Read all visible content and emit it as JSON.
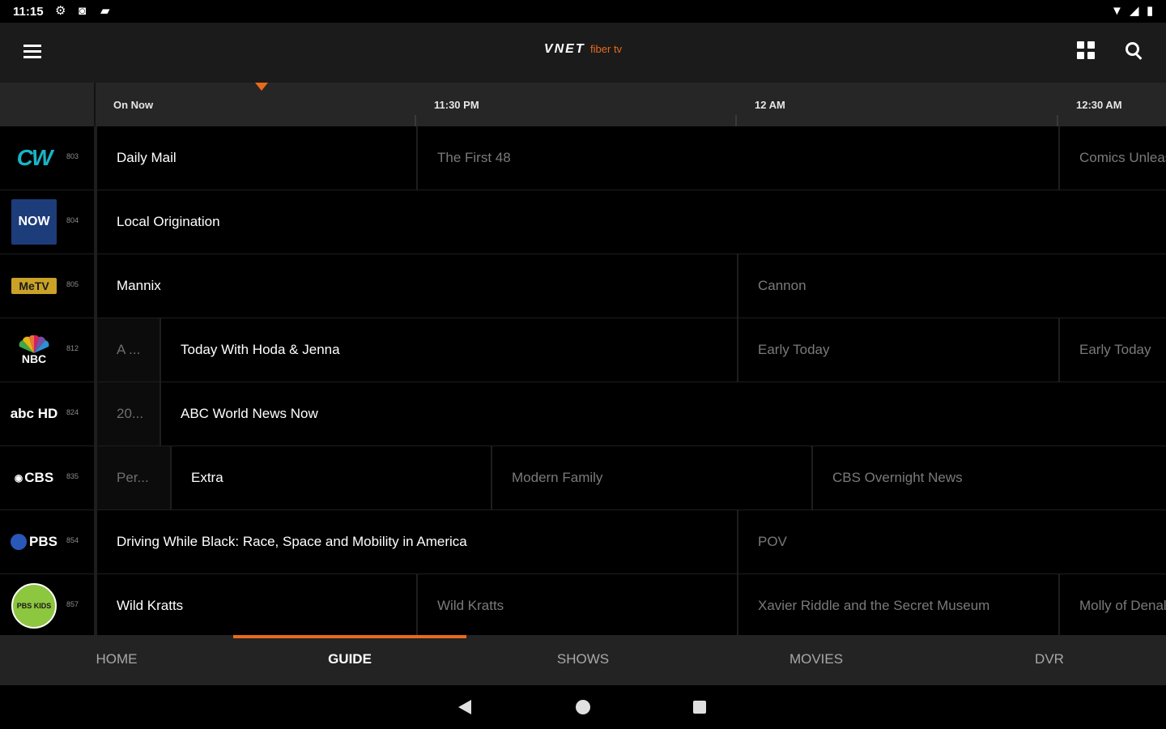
{
  "status_bar": {
    "time": "11:15",
    "left_icons": [
      "gear-icon",
      "square-icon",
      "sd-card-icon"
    ],
    "right_icons": [
      "wifi-icon",
      "signal-icon",
      "battery-icon"
    ]
  },
  "app_bar": {
    "logo_main": "VNET",
    "logo_sub": "fiber tv",
    "brand_color": "#e86a1b"
  },
  "time_header": {
    "slots": [
      "On Now",
      "11:30 PM",
      "12 AM",
      "12:30 AM"
    ]
  },
  "channels": [
    {
      "logo": "CW",
      "logo_color": "#19b4c6",
      "number": "803",
      "programs": [
        {
          "title": "Daily Mail",
          "state": "current"
        },
        {
          "title": "The First 48",
          "state": "future"
        },
        {
          "title": "Comics Unleashed",
          "state": "future"
        }
      ]
    },
    {
      "logo": "NOW",
      "logo_color": "#1d3c7a",
      "number": "804",
      "programs": [
        {
          "title": "Local Origination",
          "state": "current"
        }
      ]
    },
    {
      "logo": "MeTV",
      "logo_color": "#c9a227",
      "number": "805",
      "programs": [
        {
          "title": "Mannix",
          "state": "current"
        },
        {
          "title": "Cannon",
          "state": "future"
        }
      ]
    },
    {
      "logo": "NBC",
      "logo_color": "#ffffff",
      "number": "812",
      "programs": [
        {
          "title": "A ...",
          "state": "past"
        },
        {
          "title": "Today With Hoda & Jenna",
          "state": "current"
        },
        {
          "title": "Early Today",
          "state": "future"
        },
        {
          "title": "Early Today",
          "state": "future"
        }
      ]
    },
    {
      "logo": "abc HD",
      "logo_color": "#ffffff",
      "number": "824",
      "programs": [
        {
          "title": "20...",
          "state": "past"
        },
        {
          "title": "ABC World News Now",
          "state": "current"
        }
      ]
    },
    {
      "logo": "CBS",
      "logo_color": "#ffffff",
      "number": "835",
      "programs": [
        {
          "title": "Per...",
          "state": "past"
        },
        {
          "title": "Extra",
          "state": "current"
        },
        {
          "title": "Modern Family",
          "state": "future"
        },
        {
          "title": "CBS Overnight News",
          "state": "future"
        }
      ]
    },
    {
      "logo": "PBS",
      "logo_color": "#ffffff",
      "number": "854",
      "programs": [
        {
          "title": "Driving While Black: Race, Space and Mobility in America",
          "state": "current"
        },
        {
          "title": "POV",
          "state": "future"
        }
      ]
    },
    {
      "logo": "PBS KIDS",
      "logo_color": "#8dc63f",
      "number": "857",
      "programs": [
        {
          "title": "Wild Kratts",
          "state": "current"
        },
        {
          "title": "Wild Kratts",
          "state": "future"
        },
        {
          "title": "Xavier Riddle and the Secret Museum",
          "state": "future"
        },
        {
          "title": "Molly of Denali",
          "state": "future"
        }
      ]
    }
  ],
  "tabs": [
    {
      "label": "HOME",
      "active": false
    },
    {
      "label": "GUIDE",
      "active": true
    },
    {
      "label": "SHOWS",
      "active": false
    },
    {
      "label": "MOVIES",
      "active": false
    },
    {
      "label": "DVR",
      "active": false
    }
  ],
  "nav_bar": {
    "icons": [
      "back-icon",
      "home-icon",
      "recents-icon"
    ]
  }
}
